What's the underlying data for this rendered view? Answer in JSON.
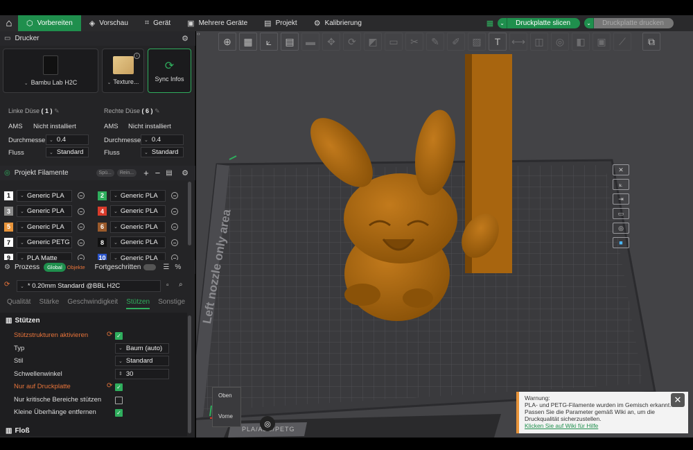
{
  "nav": {
    "tabs": [
      {
        "label": "Vorbereiten",
        "icon": "cube-icon",
        "active": true
      },
      {
        "label": "Vorschau",
        "icon": "layers-icon"
      },
      {
        "label": "Gerät",
        "icon": "device-icon"
      },
      {
        "label": "Mehrere Geräte",
        "icon": "multi-device-icon"
      },
      {
        "label": "Projekt",
        "icon": "project-icon"
      },
      {
        "label": "Kalibrierung",
        "icon": "calibration-icon"
      }
    ],
    "slice_label": "Druckplatte slicen",
    "print_label": "Druckplatte drucken"
  },
  "printer": {
    "section_title": "Drucker",
    "printer_name": "Bambu Lab H2C",
    "plate_name": "Texture...",
    "sync_label": "Sync Infos",
    "left_nozzle": {
      "title": "Linke Düse",
      "count": "( 1 )",
      "ams_label": "AMS",
      "ams_value": "Nicht installiert",
      "diam_label": "Durchmesse",
      "diam_value": "0.4",
      "flow_label": "Fluss",
      "flow_value": "Standard"
    },
    "right_nozzle": {
      "title": "Rechte Düse",
      "count": "( 6 )",
      "ams_label": "AMS",
      "ams_value": "Nicht installiert",
      "diam_label": "Durchmesse",
      "diam_value": "0.4",
      "flow_label": "Fluss",
      "flow_value": "Standard"
    }
  },
  "filaments": {
    "section_title": "Projekt Filamente",
    "pill1": "Spü...",
    "pill2": "Rein...",
    "items": [
      {
        "n": "1",
        "name": "Generic PLA",
        "color": "#ffffff",
        "fg": "#000000"
      },
      {
        "n": "2",
        "name": "Generic PLA",
        "color": "#2fae5d",
        "fg": "#ffffff"
      },
      {
        "n": "3",
        "name": "Generic PLA",
        "color": "#8a8a8a",
        "fg": "#ffffff"
      },
      {
        "n": "4",
        "name": "Generic PLA",
        "color": "#d93b2b",
        "fg": "#ffffff"
      },
      {
        "n": "5",
        "name": "Generic PLA",
        "color": "#e8943a",
        "fg": "#ffffff"
      },
      {
        "n": "6",
        "name": "Generic PLA",
        "color": "#9a5a2b",
        "fg": "#ffffff"
      },
      {
        "n": "7",
        "name": "Generic PETG",
        "color": "#ffffff",
        "fg": "#000000"
      },
      {
        "n": "8",
        "name": "Generic PLA",
        "color": "#111111",
        "fg": "#ffffff"
      },
      {
        "n": "9",
        "name": "PLA Matte",
        "color": "#ffffff",
        "fg": "#000000"
      },
      {
        "n": "10",
        "name": "Generic PLA",
        "color": "#2b54c9",
        "fg": "#ffffff"
      }
    ]
  },
  "process": {
    "section_title": "Prozess",
    "global_label": "Global",
    "objects_label": "Objekte",
    "advanced_label": "Fortgeschritten",
    "preset": "* 0.20mm Standard @BBL H2C",
    "tabs": [
      "Qualität",
      "Stärke",
      "Geschwindigkeit",
      "Stützen",
      "Sonstige"
    ],
    "active_tab": "Stützen",
    "group_title": "Stützen",
    "props": [
      {
        "label": "Stützstrukturen aktivieren",
        "modified": true,
        "type": "check",
        "checked": true
      },
      {
        "label": "Typ",
        "type": "select",
        "value": "Baum (auto)"
      },
      {
        "label": "Stil",
        "type": "select",
        "value": "Standard"
      },
      {
        "label": "Schwellenwinkel",
        "type": "spin",
        "value": "30"
      },
      {
        "label": "Nur auf Druckplatte",
        "modified": true,
        "type": "check",
        "checked": true
      },
      {
        "label": "Nur kritische Bereiche stützen",
        "type": "check",
        "checked": false
      },
      {
        "label": "Kleine Überhänge entfernen",
        "type": "check",
        "checked": true
      }
    ],
    "next_group": "Floß"
  },
  "viewport": {
    "bed_label": "Left nozzle only area",
    "plate_text": "PLA/ABS/PETG",
    "view_top": "Oben",
    "view_front": "Vorne"
  },
  "warning": {
    "title": "Warnung:",
    "body": "PLA- und PETG-Filamente wurden im Gemisch erkannt. Passen Sie die Parameter gemäß Wiki an, um die Druckqualität sicherzustellen.",
    "link": "Klicken Sie auf Wiki für Hilfe"
  },
  "colors": {
    "accent": "#1f8f4d",
    "model": "#a8650f",
    "warning": "#e8943a"
  }
}
